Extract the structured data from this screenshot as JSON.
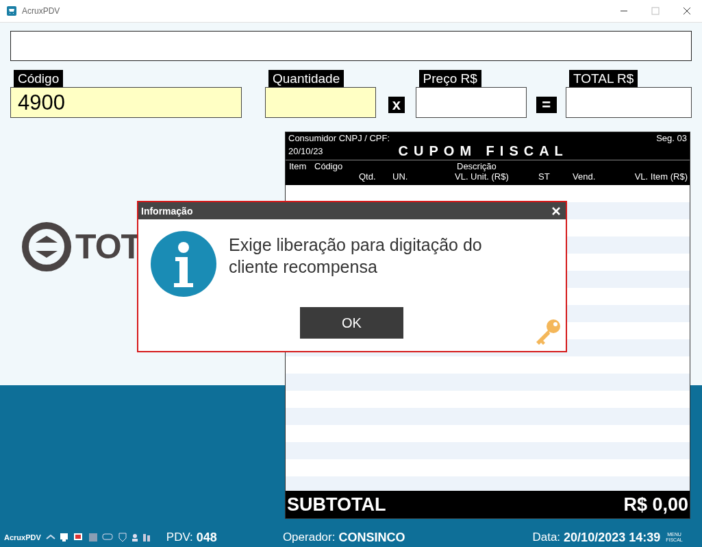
{
  "window": {
    "title": "AcruxPDV"
  },
  "fields": [
    {
      "label": "Código",
      "value": "4900",
      "kind": "input"
    },
    {
      "label": "Quantidade",
      "kind": "input",
      "op": "x"
    },
    {
      "label": "Preço R$",
      "kind": "input",
      "op": "="
    },
    {
      "label": "TOTAL R$",
      "kind": "input"
    }
  ],
  "logo": {
    "text": "TOT"
  },
  "receipt": {
    "consumer": "Consumidor CNPJ / CPF:",
    "seq": "Seg. 03",
    "date": "20/10/23",
    "title": "CUPOM FISCAL",
    "header_top": [
      "Item",
      "Código",
      "Descrição"
    ],
    "header_bottom": [
      "Qtd.",
      "UN.",
      "VL. Unit. (R$)",
      "ST",
      "Vend.",
      "VL. Item (R$)"
    ],
    "subtotal_label": "SUBTOTAL",
    "subtotal_value": "R$ 0,00"
  },
  "dialog": {
    "title": "Informação",
    "message": "Exige liberação para digitação do cliente recompensa",
    "button": "OK"
  },
  "status_bar": {
    "app": "AcruxPDV",
    "pdv_label": "PDV:",
    "pdv": "048",
    "operator_label": "Operador:",
    "operator": "CONSINCO",
    "date_label": "Data:",
    "date": "20/10/2023 14:39",
    "menu": [
      "MENU",
      "FISCAL"
    ]
  }
}
